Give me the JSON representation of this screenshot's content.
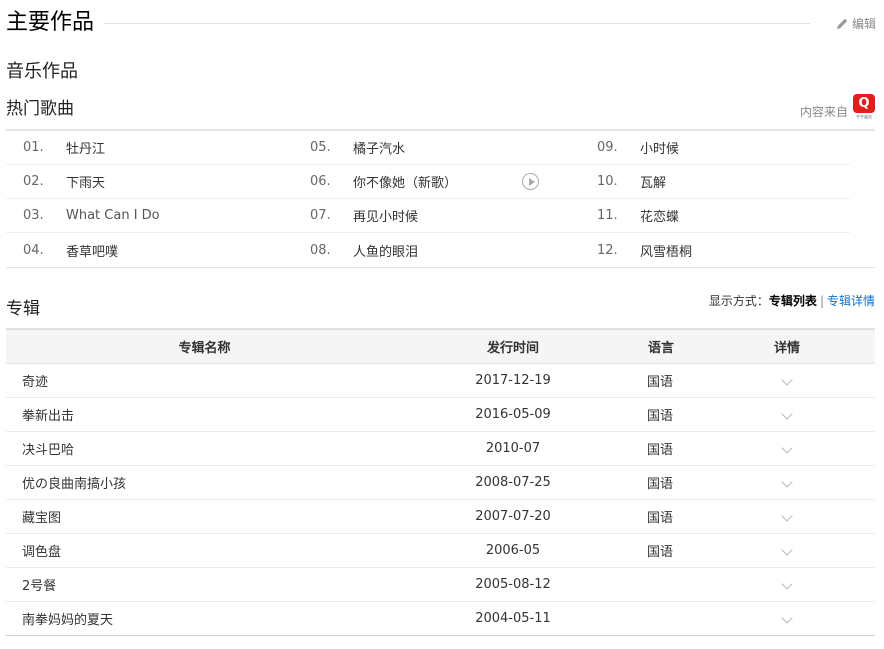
{
  "header": {
    "title": "主要作品",
    "edit_label": "编辑"
  },
  "music_section": {
    "title": "音乐作品"
  },
  "hot_songs": {
    "title": "热门歌曲",
    "source_label": "内容来自",
    "source_logo_text": "千千音乐",
    "columns": [
      [
        {
          "num": "01.",
          "name": "牡丹江"
        },
        {
          "num": "02.",
          "name": "下雨天"
        },
        {
          "num": "03.",
          "name": "What Can I Do"
        },
        {
          "num": "04.",
          "name": "香草吧噗"
        }
      ],
      [
        {
          "num": "05.",
          "name": "橘子汽水"
        },
        {
          "num": "06.",
          "name": "你不像她（新歌）"
        },
        {
          "num": "07.",
          "name": "再见小时候"
        },
        {
          "num": "08.",
          "name": "人鱼的眼泪"
        }
      ],
      [
        {
          "num": "09.",
          "name": "小时候"
        },
        {
          "num": "10.",
          "name": "瓦解"
        },
        {
          "num": "11.",
          "name": "花恋蝶"
        },
        {
          "num": "12.",
          "name": "风雪梧桐"
        }
      ]
    ]
  },
  "albums": {
    "title": "专辑",
    "display_mode": {
      "label": "显示方式：",
      "active": "专辑列表",
      "separator": "|",
      "other": "专辑详情"
    },
    "headers": {
      "name": "专辑名称",
      "date": "发行时间",
      "lang": "语言",
      "detail": "详情"
    },
    "rows": [
      {
        "name": "奇迹",
        "date": "2017-12-19",
        "lang": "国语"
      },
      {
        "name": "拳新出击",
        "date": "2016-05-09",
        "lang": "国语"
      },
      {
        "name": "决斗巴哈",
        "date": "2010-07",
        "lang": "国语"
      },
      {
        "name": "优の良曲南搞小孩",
        "date": "2008-07-25",
        "lang": "国语"
      },
      {
        "name": "藏宝图",
        "date": "2007-07-20",
        "lang": "国语"
      },
      {
        "name": "调色盘",
        "date": "2006-05",
        "lang": "国语"
      },
      {
        "name": "2号餐",
        "date": "2005-08-12",
        "lang": ""
      },
      {
        "name": "南拳妈妈的夏天",
        "date": "2004-05-11",
        "lang": ""
      }
    ]
  },
  "colors": {
    "link": "#136ec2",
    "logo_red": "#e0201b",
    "border": "#e4e4e4",
    "header_bg": "#f5f5f5"
  }
}
